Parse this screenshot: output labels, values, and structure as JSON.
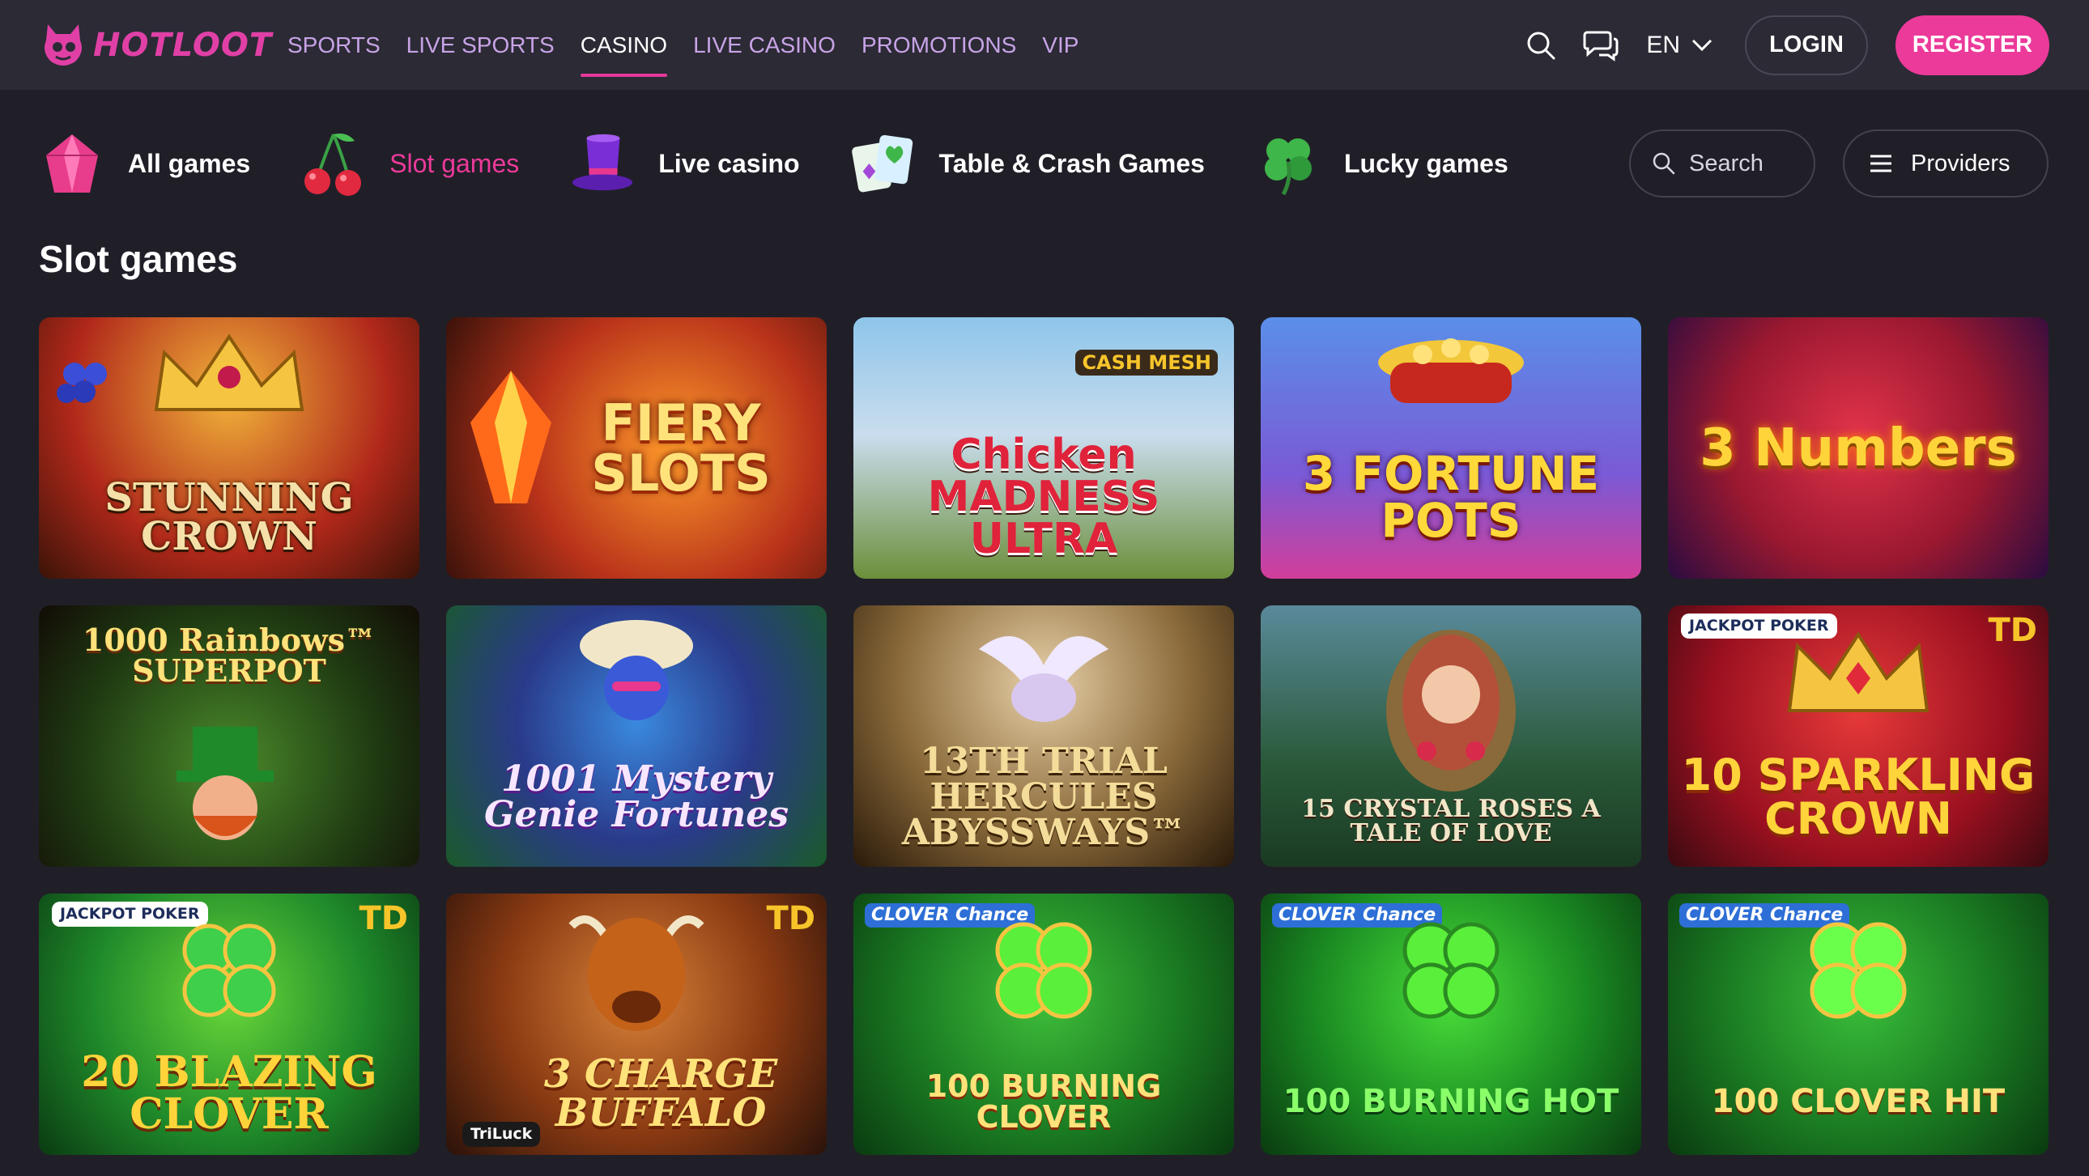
{
  "header": {
    "logo_text": "HOTLOOT",
    "nav": [
      {
        "label": "SPORTS",
        "active": false
      },
      {
        "label": "LIVE SPORTS",
        "active": false
      },
      {
        "label": "CASINO",
        "active": true
      },
      {
        "label": "LIVE CASINO",
        "active": false
      },
      {
        "label": "PROMOTIONS",
        "active": false
      },
      {
        "label": "VIP",
        "active": false
      }
    ],
    "language": "EN",
    "login_label": "LOGIN",
    "register_label": "REGISTER",
    "icons": [
      "search-icon",
      "chat-icon",
      "chevron-down-icon"
    ]
  },
  "categories": [
    {
      "label": "All games",
      "icon": "gem-icon",
      "active": false
    },
    {
      "label": "Slot games",
      "icon": "cherries-icon",
      "active": true
    },
    {
      "label": "Live casino",
      "icon": "top-hat-icon",
      "active": false
    },
    {
      "label": "Table & Crash Games",
      "icon": "cards-icon",
      "active": false
    },
    {
      "label": "Lucky games",
      "icon": "clover-icon",
      "active": false
    }
  ],
  "search": {
    "placeholder": "Search"
  },
  "providers_label": "Providers",
  "section_title": "Slot games",
  "games": [
    {
      "title": "STUNNING CROWN"
    },
    {
      "title": "FIERY SLOTS"
    },
    {
      "title": "Chicken MADNESS ULTRA",
      "badge": "CASH MESH"
    },
    {
      "title": "3 FORTUNE POTS"
    },
    {
      "title": "3 Numbers"
    },
    {
      "title": "1000 Rainbows™ SUPERPOT"
    },
    {
      "title": "1001 Mystery Genie Fortunes"
    },
    {
      "title": "13TH TRIAL HERCULES ABYSSWAYS™"
    },
    {
      "title": "15 CRYSTAL ROSES A TALE OF LOVE"
    },
    {
      "title": "10 SPARKLING CROWN",
      "badge": "JACKPOT POKER",
      "td": "TD"
    },
    {
      "title": "20 BLAZING CLOVER",
      "badge": "JACKPOT POKER",
      "td": "TD"
    },
    {
      "title": "3 CHARGE BUFFALO",
      "badge": "TriLuck",
      "td": "TD"
    },
    {
      "title": "100 BURNING CLOVER",
      "badge": "CLOVER Chance"
    },
    {
      "title": "100 BURNING HOT",
      "badge": "CLOVER Chance"
    },
    {
      "title": "100 CLOVER HIT",
      "badge": "CLOVER Chance"
    }
  ],
  "colors": {
    "accent": "#ec3a9a",
    "header_bg": "#2b2a35",
    "page_bg": "#201f28",
    "nav_text": "#c8a3e6"
  }
}
